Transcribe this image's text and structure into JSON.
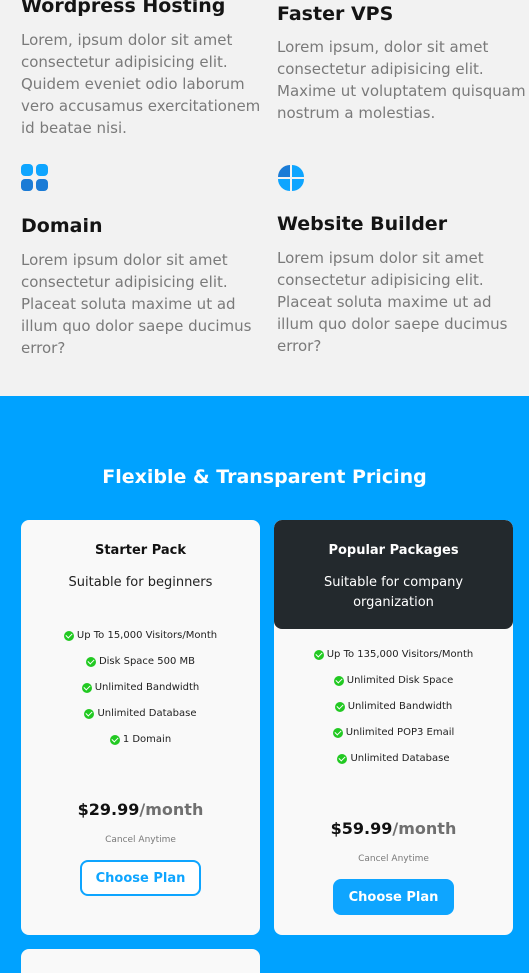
{
  "services": [
    {
      "title": "Wordpress Hosting",
      "lines": [
        "Lorem, ipsum dolor sit amet",
        "consectetur adipisicing elit.",
        "Quidem eveniet odio laborum",
        "vero accusamus exercitationem",
        "id beatae nisi."
      ],
      "icon": null
    },
    {
      "title": "Faster VPS",
      "lines": [
        "Lorem ipsum, dolor sit amet",
        "consectetur adipisicing elit.",
        "Maxime ut voluptatem quisquam",
        "nostrum a molestias."
      ],
      "icon": null
    },
    {
      "title": "Domain",
      "lines": [
        "Lorem ipsum dolor sit amet",
        "consectetur adipisicing elit.",
        "Placeat soluta maxime ut ad",
        "illum quo dolor saepe ducimus",
        "error?"
      ],
      "icon": "grid-squares-icon"
    },
    {
      "title": "Website Builder",
      "lines": [
        "Lorem ipsum dolor sit amet",
        "consectetur adipisicing elit.",
        "Placeat soluta maxime ut ad",
        "illum quo dolor saepe ducimus",
        "error?"
      ],
      "icon": "pie-quarters-icon"
    }
  ],
  "pricing": {
    "title": "Flexible & Transparent Pricing",
    "plans": [
      {
        "name": "Starter Pack",
        "subtitle_lines": [
          "Suitable for beginners"
        ],
        "features": [
          "Up To 15,000 Visitors/Month",
          "Disk Space 500 MB",
          "Unlimited Bandwidth",
          "Unlimited Database",
          "1 Domain"
        ],
        "price": "$29.99",
        "period": "/month",
        "note": "Cancel Anytime",
        "button": "Choose Plan"
      },
      {
        "name": "Popular Packages",
        "subtitle_lines": [
          "Suitable for company",
          "organization"
        ],
        "features": [
          "Up To 135,000 Visitors/Month",
          "Unlimited Disk Space",
          "Unlimited Bandwidth",
          "Unlimited POP3 Email",
          "Unlimited Database"
        ],
        "price": "$59.99",
        "period": "/month",
        "note": "Cancel Anytime",
        "button": "Choose Plan"
      }
    ]
  },
  "colors": {
    "accent": "#0ea5ff",
    "pricing_background": "#00a2ff",
    "dark_header": "#23292d",
    "check": "#22c922"
  }
}
